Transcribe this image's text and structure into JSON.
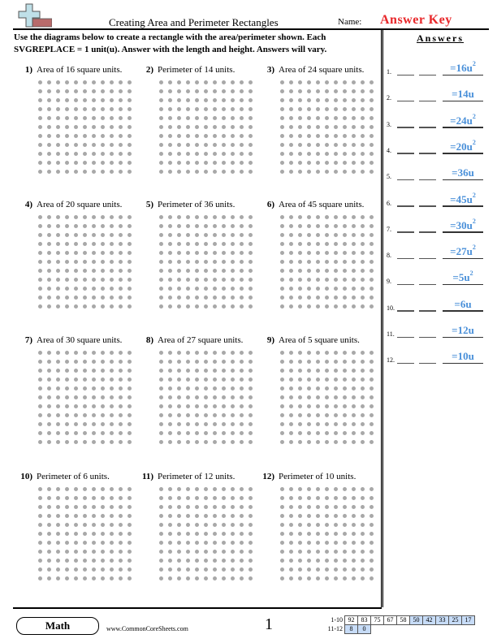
{
  "header": {
    "title": "Creating Area and Perimeter Rectangles",
    "name_label": "Name:",
    "answer_key": "Answer Key",
    "logo_icon": "plus-minus-logo-icon"
  },
  "instructions": "Use the diagrams below to create a rectangle with the area/perimeter shown. Each SVGREPLACE = 1 unit(u). Answer with the length and height. Answers will vary.",
  "problems": [
    {
      "num": "1)",
      "text": "Area of 16 square units."
    },
    {
      "num": "2)",
      "text": "Perimeter of 14 units."
    },
    {
      "num": "3)",
      "text": "Area of 24 square units."
    },
    {
      "num": "4)",
      "text": "Area of 20 square units."
    },
    {
      "num": "5)",
      "text": "Perimeter of 36 units."
    },
    {
      "num": "6)",
      "text": "Area of 45 square units."
    },
    {
      "num": "7)",
      "text": "Area of 30 square units."
    },
    {
      "num": "8)",
      "text": "Area of 27 square units."
    },
    {
      "num": "9)",
      "text": "Area of 5 square units."
    },
    {
      "num": "10)",
      "text": "Perimeter of 6 units."
    },
    {
      "num": "11)",
      "text": "Perimeter of 12 units."
    },
    {
      "num": "12)",
      "text": "Perimeter of 10 units."
    }
  ],
  "dot_grid": {
    "columns": 11,
    "rows": 11,
    "dot_color": "#a8a8a8"
  },
  "answers": {
    "title": "Answers",
    "items": [
      {
        "num": "1.",
        "value": "=16u",
        "squared": true
      },
      {
        "num": "2.",
        "value": "=14u",
        "squared": false
      },
      {
        "num": "3.",
        "value": "=24u",
        "squared": true
      },
      {
        "num": "4.",
        "value": "=20u",
        "squared": true
      },
      {
        "num": "5.",
        "value": "=36u",
        "squared": false
      },
      {
        "num": "6.",
        "value": "=45u",
        "squared": true
      },
      {
        "num": "7.",
        "value": "=30u",
        "squared": true
      },
      {
        "num": "8.",
        "value": "=27u",
        "squared": true
      },
      {
        "num": "9.",
        "value": "=5u",
        "squared": true
      },
      {
        "num": "10.",
        "value": "=6u",
        "squared": false
      },
      {
        "num": "11.",
        "value": "=12u",
        "squared": false
      },
      {
        "num": "12.",
        "value": "=10u",
        "squared": false
      }
    ],
    "exponent": "2",
    "value_color": "#4a90d9"
  },
  "footer": {
    "subject": "Math",
    "website": "www.CommonCoreSheets.com",
    "page": "1",
    "score_rows": [
      {
        "label": "1-10",
        "cells": [
          "92",
          "83",
          "75",
          "67",
          "58",
          "50",
          "42",
          "33",
          "25",
          "17"
        ],
        "blue_from": 5
      },
      {
        "label": "11-12",
        "cells": [
          "8",
          "0"
        ],
        "blue_from": 0
      }
    ]
  }
}
